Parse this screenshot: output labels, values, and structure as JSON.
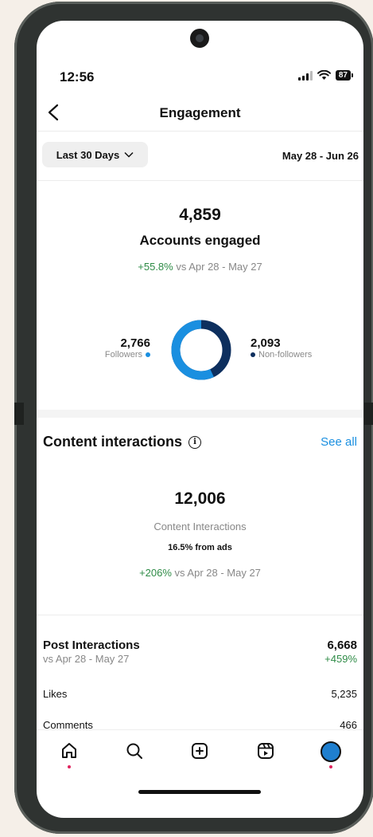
{
  "status": {
    "time": "12:56",
    "battery": "87"
  },
  "header": {
    "title": "Engagement"
  },
  "filter": {
    "range_label": "Last 30 Days",
    "date_range": "May 28 - Jun 26"
  },
  "accounts": {
    "count": "4,859",
    "label": "Accounts engaged",
    "change": "+55.8%",
    "compare": "vs Apr 28 - May 27",
    "followers_count": "2,766",
    "followers_label": "Followers",
    "nonfollowers_count": "2,093",
    "nonfollowers_label": "Non-followers",
    "followers_share": 0.569,
    "colors": {
      "followers": "#1a8fe0",
      "nonfollowers": "#0d2f5e"
    }
  },
  "content": {
    "title": "Content interactions",
    "see_all": "See all",
    "count": "12,006",
    "label": "Content Interactions",
    "ads": "16.5% from ads",
    "change": "+206%",
    "compare": "vs Apr 28 - May 27"
  },
  "post": {
    "title": "Post Interactions",
    "compare": "vs Apr 28 - May 27",
    "total": "6,668",
    "change": "+459%",
    "rows": [
      {
        "label": "Likes",
        "value": "5,235"
      },
      {
        "label": "Comments",
        "value": "466"
      }
    ]
  },
  "nav": {
    "items": [
      "home-icon",
      "search-icon",
      "create-icon",
      "reels-icon",
      "profile-avatar"
    ]
  },
  "accent_colors": {
    "link": "#1a8fe0",
    "positive": "#2e8b46"
  }
}
